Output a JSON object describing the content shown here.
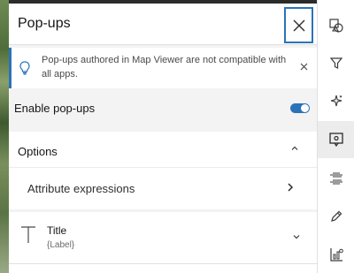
{
  "header": {
    "title": "Pop-ups"
  },
  "notice": {
    "text": "Pop-ups authored in Map Viewer are not compatible with all apps.",
    "icon": "lightbulb-icon"
  },
  "enable_popups": {
    "label": "Enable pop-ups",
    "enabled": true
  },
  "options": {
    "title": "Options",
    "expanded": true,
    "items": [
      {
        "label": "Attribute expressions"
      }
    ]
  },
  "title_card": {
    "title": "Title",
    "subtitle": "{Label}",
    "icon": "text-t-icon"
  },
  "actionbar": {
    "items": [
      {
        "name": "layer-style-icon"
      },
      {
        "name": "filter-icon"
      },
      {
        "name": "effects-icon"
      },
      {
        "name": "popup-icon",
        "active": true
      },
      {
        "name": "fields-icon"
      },
      {
        "name": "edit-icon"
      },
      {
        "name": "charts-icon"
      }
    ]
  },
  "colors": {
    "accent": "#2a73b8",
    "panel": "#f3f3f3",
    "text": "#151515"
  }
}
